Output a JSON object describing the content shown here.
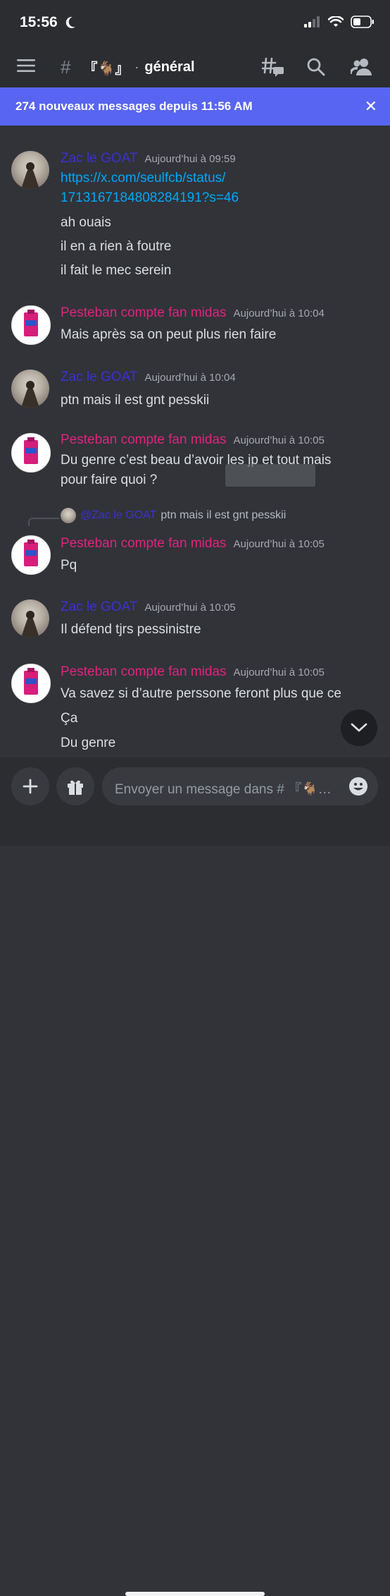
{
  "status_bar": {
    "time": "15:56"
  },
  "header": {
    "channel_emoji": "『🐐』",
    "separator": "·",
    "channel_name": "général"
  },
  "banner": {
    "text": "274 nouveaux messages depuis 11:56 AM",
    "close": "✕"
  },
  "messages": [
    {
      "author": "Zac le GOAT",
      "timestamp": "Aujourd’hui à 09:59",
      "link_line1": "https://x.com/seulfcb/status/",
      "link_line2": "1713167184808284191?s=46",
      "lines": [
        "ah ouais",
        "il en a rien à foutre",
        "il fait le mec serein"
      ]
    },
    {
      "author": "Pesteban compte fan midas",
      "timestamp": "Aujourd’hui à 10:04",
      "lines": [
        "Mais après sa on peut plus rien faire"
      ]
    },
    {
      "author": "Zac le GOAT",
      "timestamp": "Aujourd’hui à 10:04",
      "lines": [
        "ptn mais il est gnt pesskii"
      ]
    },
    {
      "author": "Pesteban compte fan midas",
      "timestamp": "Aujourd’hui à 10:05",
      "lines": [
        "Du genre c’est beau d’avoir les jp et tout mais",
        "pour faire quoi ?"
      ]
    },
    {
      "author": "Pesteban compte fan midas",
      "timestamp": "Aujourd’hui à 10:05",
      "reply_to": {
        "mention": "@Zac le GOAT",
        "text": "ptn mais il est gnt pesskii"
      },
      "lines": [
        "Pq"
      ]
    },
    {
      "author": "Zac le GOAT",
      "timestamp": "Aujourd’hui à 10:05",
      "lines": [
        "Il défend tjrs pessinistre"
      ]
    },
    {
      "author": "Pesteban compte fan midas",
      "timestamp": "Aujourd’hui à 10:05",
      "lines": [
        "Va savez si d’autre perssone feront plus que ce",
        "Ça",
        "Du genre"
      ]
    }
  ],
  "composer": {
    "placeholder": "Envoyer un message dans # 『🐐…"
  },
  "colors": {
    "background": "#313338",
    "bar": "#2b2d31",
    "banner": "#5865f2",
    "zac": "#3b30d6",
    "pesteban": "#e0237f",
    "link": "#00a8fc"
  },
  "icons": [
    "menu-icon",
    "hash-icon",
    "threads-icon",
    "search-icon",
    "members-icon",
    "close-icon",
    "chevron-down-icon",
    "plus-icon",
    "gift-icon",
    "emoji-icon"
  ]
}
